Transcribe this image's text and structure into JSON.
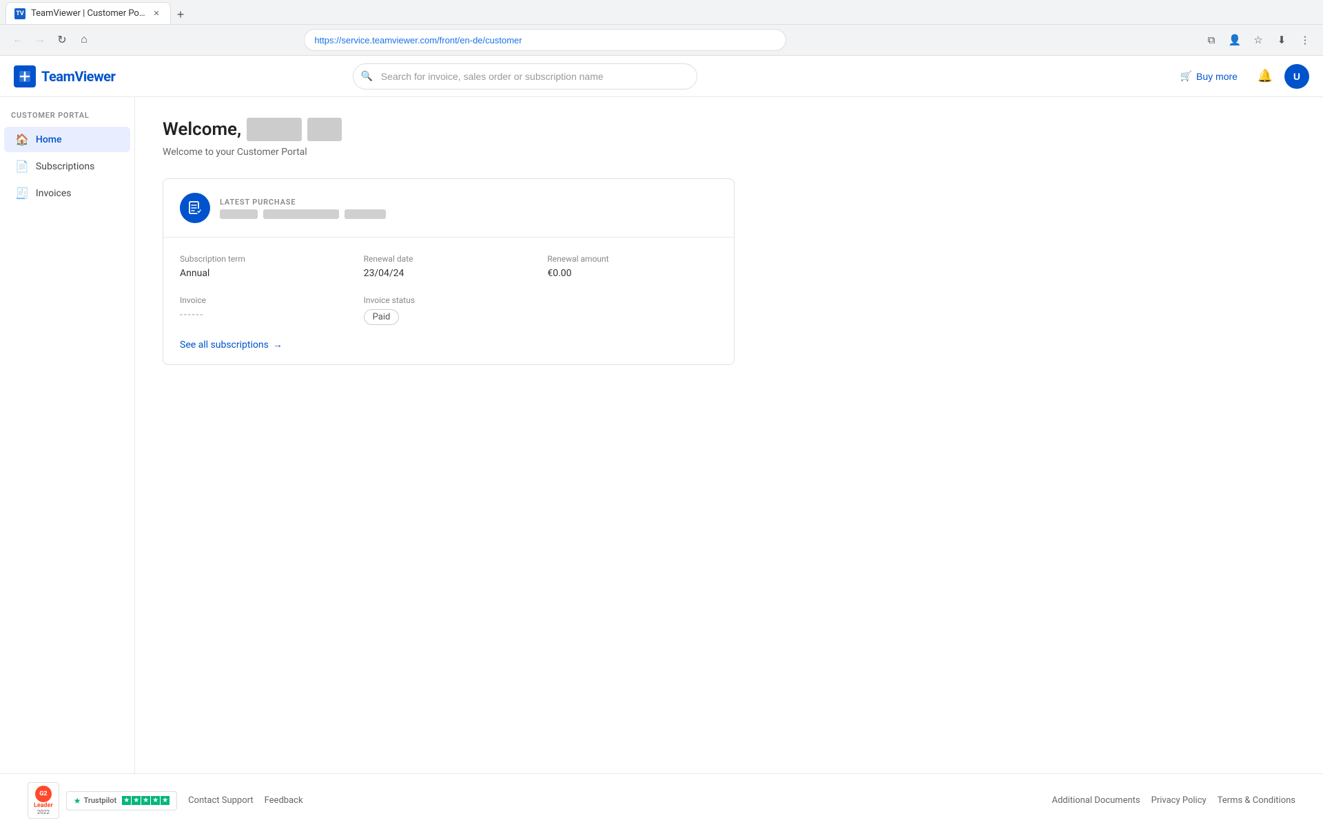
{
  "browser": {
    "url": "https://service.teamviewer.com/front/en-de/customer",
    "tab_title": "TeamViewer | Customer Portal",
    "tab_favicon": "TV"
  },
  "header": {
    "logo_text": "TeamViewer",
    "search_placeholder": "Search for invoice, sales order or subscription name",
    "buy_more_label": "Buy more",
    "cart_icon": "🛒",
    "notification_icon": "🔔"
  },
  "sidebar": {
    "section_label": "CUSTOMER PORTAL",
    "items": [
      {
        "id": "home",
        "label": "Home",
        "icon": "🏠",
        "active": true
      },
      {
        "id": "subscriptions",
        "label": "Subscriptions",
        "icon": "📄",
        "active": false
      },
      {
        "id": "invoices",
        "label": "Invoices",
        "icon": "🧾",
        "active": false
      }
    ]
  },
  "page": {
    "welcome_prefix": "Welcome,",
    "welcome_name_blurred": true,
    "subtitle": "Welcome to your Customer Portal"
  },
  "subscription_card": {
    "latest_purchase_label": "LATEST PURCHASE",
    "product_blurred": true,
    "subscription_term_label": "Subscription term",
    "subscription_term_value": "Annual",
    "renewal_date_label": "Renewal date",
    "renewal_date_value": "23/04/24",
    "renewal_amount_label": "Renewal amount",
    "renewal_amount_value": "€0.00",
    "invoice_label": "Invoice",
    "invoice_value": "------",
    "invoice_status_label": "Invoice status",
    "invoice_status_value": "Paid",
    "see_all_subscriptions_label": "See all subscriptions",
    "arrow_icon": "→"
  },
  "footer": {
    "contact_support": "Contact Support",
    "feedback": "Feedback",
    "additional_documents": "Additional Documents",
    "privacy_policy": "Privacy Policy",
    "terms_conditions": "Terms & Conditions",
    "trustpilot_label": "Trustpilot",
    "trustpilot_stars": "★★★★★",
    "g2_label": "Leader",
    "g2_year": "2022"
  }
}
